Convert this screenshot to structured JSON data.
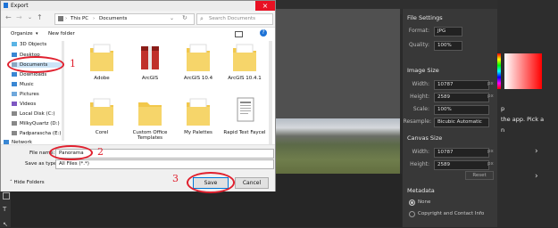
{
  "dialog": {
    "title": "Export",
    "breadcrumb": [
      "This PC",
      "Documents"
    ],
    "search_placeholder": "Search Documents",
    "organize_label": "Organize",
    "new_folder_label": "New folder",
    "sidebar": [
      "3D Objects",
      "Desktop",
      "Documents",
      "Downloads",
      "Music",
      "Pictures",
      "Videos",
      "Local Disk (C:)",
      "MilkyQuartz (D:)",
      "Padparascha (E:)",
      "Network"
    ],
    "files": [
      {
        "name": "Adobe",
        "icon": "folder-icon"
      },
      {
        "name": "ArcGIS",
        "icon": "archive-icon"
      },
      {
        "name": "ArcGIS 10.4",
        "icon": "folder-icon"
      },
      {
        "name": "ArcGIS 10.4.1",
        "icon": "folder-icon"
      },
      {
        "name": "Corel",
        "icon": "folder-icon"
      },
      {
        "name": "Custom Office Templates",
        "icon": "folder-icon"
      },
      {
        "name": "My Palettes",
        "icon": "folder-icon"
      },
      {
        "name": "Rapid Test Faycel",
        "icon": "document-icon"
      }
    ],
    "file_name_label": "File name:",
    "file_name_value": "Panorama",
    "save_type_label": "Save as type:",
    "save_type_value": "All Files (*.*)",
    "hide_folders_label": "Hide Folders",
    "save_label": "Save",
    "cancel_label": "Cancel"
  },
  "annotations": {
    "one": "1",
    "two": "2",
    "three": "3"
  },
  "panel": {
    "file_settings": "File Settings",
    "format_label": "Format:",
    "format_value": "JPG",
    "quality_label": "Quality:",
    "quality_value": "100%",
    "image_size": "Image Size",
    "width_label": "Width:",
    "width_value": "10787",
    "height_label": "Height:",
    "height_value": "2589",
    "scale_label": "Scale:",
    "scale_value": "100%",
    "resample_label": "Resample:",
    "resample_value": "Bicubic Automatic",
    "canvas_size": "Canvas Size",
    "canvas_width_value": "10787",
    "canvas_height_value": "2589",
    "reset_label": "Reset",
    "metadata": "Metadata",
    "meta_none": "None",
    "meta_copyright": "Copyright and Contact Info",
    "unit_px": "px"
  },
  "far_panel": {
    "text_line1": "p",
    "text_line2": "the app. Pick a",
    "text_line3": "n"
  },
  "colors": {
    "annotation": "#e0202e",
    "accent": "#1e73d6",
    "folder": "#f2c84b"
  }
}
